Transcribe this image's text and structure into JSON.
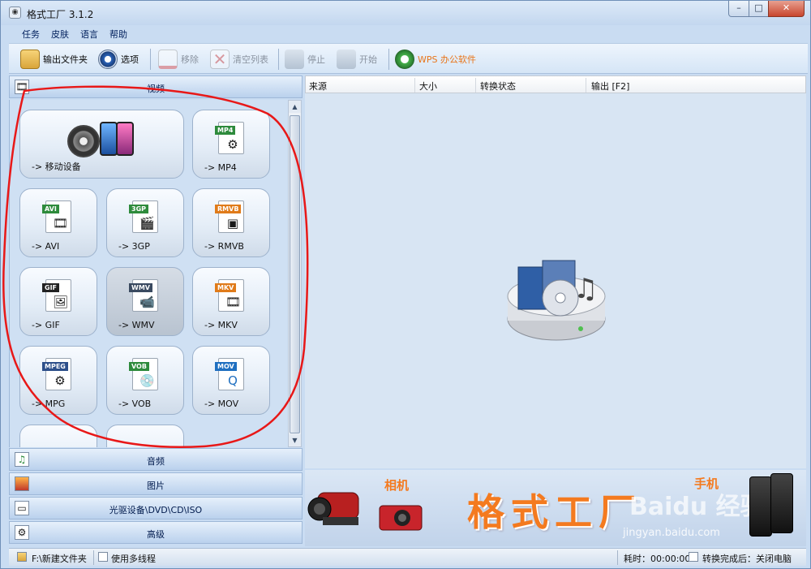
{
  "window": {
    "title": "格式工厂 3.1.2",
    "controls": {
      "minimize": "–",
      "maximize": "□",
      "close": "✕"
    }
  },
  "menu": [
    "任务",
    "皮肤",
    "语言",
    "帮助"
  ],
  "toolbar": {
    "output_folder": "输出文件夹",
    "options": "选项",
    "remove": "移除",
    "clear_list": "清空列表",
    "stop": "停止",
    "start": "开始",
    "wps": "WPS 办公软件"
  },
  "categories": {
    "video": "视频",
    "audio": "音频",
    "image": "图片",
    "rom": "光驱设备\\DVD\\CD\\ISO",
    "advanced": "高级"
  },
  "video_tiles": [
    {
      "label": "-> 移动设备"
    },
    {
      "label": "-> MP4",
      "tag": "MP4",
      "color": "#2e8b3c"
    },
    {
      "label": "-> AVI",
      "tag": "AVI",
      "color": "#2e8b3c"
    },
    {
      "label": "-> 3GP",
      "tag": "3GP",
      "color": "#2e8b3c"
    },
    {
      "label": "-> RMVB",
      "tag": "RMVB",
      "color": "#e07b1a"
    },
    {
      "label": "-> GIF",
      "tag": "GIF",
      "color": "#222222"
    },
    {
      "label": "-> WMV",
      "tag": "WMV",
      "color": "#3a4a60"
    },
    {
      "label": "-> MKV",
      "tag": "MKV",
      "color": "#e07b1a"
    },
    {
      "label": "-> MPG",
      "tag": "MPEG",
      "color": "#2d4f8a"
    },
    {
      "label": "-> VOB",
      "tag": "VOB",
      "color": "#2e8b3c"
    },
    {
      "label": "-> MOV",
      "tag": "MOV",
      "color": "#1f6fc0"
    }
  ],
  "task_list": {
    "columns": [
      "来源",
      "大小",
      "转换状态",
      "输出 [F2]"
    ]
  },
  "banner": {
    "camera_label": "相机",
    "title": "格式工厂",
    "phone_label": "手机",
    "watermark": "Baidu 经验",
    "watermark_sub": "jingyan.baidu.com"
  },
  "status": {
    "output_path": "F:\\新建文件夹",
    "multithread": "使用多线程",
    "elapsed": "耗时：00:00:00",
    "after_done": "转换完成后：关闭电脑"
  }
}
